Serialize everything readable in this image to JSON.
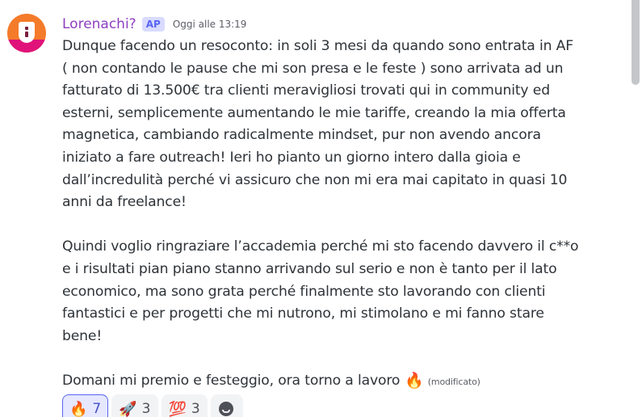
{
  "message": {
    "username": "Lorenachi?",
    "tag": "AP",
    "timestamp": "Oggi alle 13:19",
    "paragraphs": [
      "Dunque facendo un resoconto: in soli 3 mesi da quando sono entrata in AF ( non contando le pause che mi son presa e le feste ) sono arrivata ad un fatturato di 13.500€ tra clienti meravigliosi trovati qui in community ed esterni, semplicemente aumentando le mie tariffe, creando la mia offerta magnetica, cambiando radicalmente mindset, pur non avendo ancora iniziato a fare outreach! Ieri ho pianto un giorno intero dalla gioia e dall’incredulità perché vi assicuro che non mi era mai capitato in quasi 10 anni da freelance!",
      "Quindi voglio ringraziare l’accademia perché mi sto facendo davvero il c**o e i risultati pian piano stanno arrivando sul serio e non è tanto per il lato economico, ma sono grata perché finalmente sto lavorando con clienti fantastici e per progetti che mi nutrono, mi stimolano e mi fanno stare bene!",
      "Domani mi premio e festeggio, ora torno a lavoro"
    ],
    "inline_emoji": "🔥",
    "edited_label": "(modificato)"
  },
  "reactions": [
    {
      "emoji": "🔥",
      "count": "7",
      "active": true
    },
    {
      "emoji": "🚀",
      "count": "3",
      "active": false
    },
    {
      "emoji": "💯",
      "count": "3",
      "active": false
    }
  ],
  "add_reaction_icon": "smile-plus-icon"
}
